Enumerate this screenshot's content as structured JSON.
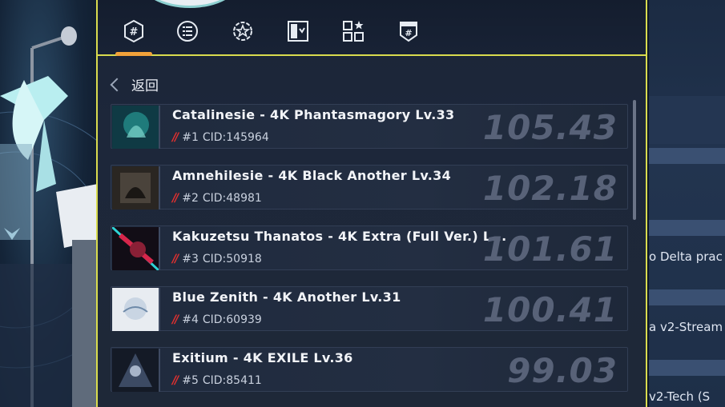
{
  "tabs": [
    {
      "icon": "hash-badge-icon"
    },
    {
      "icon": "list-icon"
    },
    {
      "icon": "badge-star-icon"
    },
    {
      "icon": "chart-cards-icon"
    },
    {
      "icon": "grid-star-icon"
    },
    {
      "icon": "hash-box-icon"
    }
  ],
  "back_label": "返回",
  "records": [
    {
      "title": "Catalinesie - 4K Phantasmagory Lv.33",
      "rank": "#1",
      "cid": "CID:145964",
      "score": "105.43",
      "cover": "cover-catalinesie"
    },
    {
      "title": "Amnehilesie - 4K Black Another Lv.34",
      "rank": "#2",
      "cid": "CID:48981",
      "score": "102.18",
      "cover": "cover-amnehilesie"
    },
    {
      "title": "Kakuzetsu Thanatos - 4K Extra (Full Ver.) L...",
      "rank": "#3",
      "cid": "CID:50918",
      "score": "101.61",
      "cover": "cover-kakuzetsu"
    },
    {
      "title": "Blue Zenith - 4K Another Lv.31",
      "rank": "#4",
      "cid": "CID:60939",
      "score": "100.41",
      "cover": "cover-blue-zenith"
    },
    {
      "title": "Exitium - 4K EXILE Lv.36",
      "rank": "#5",
      "cid": "CID:85411",
      "score": "99.03",
      "cover": "cover-exitium"
    }
  ],
  "right_bg": {
    "line1": "o Delta prac",
    "line2": "a v2-Stream",
    "line3": "v2-Tech (S"
  },
  "colors": {
    "accent": "#d9dc4e",
    "tab_active": "#f2a23a",
    "rank_slash": "#e0302f"
  }
}
